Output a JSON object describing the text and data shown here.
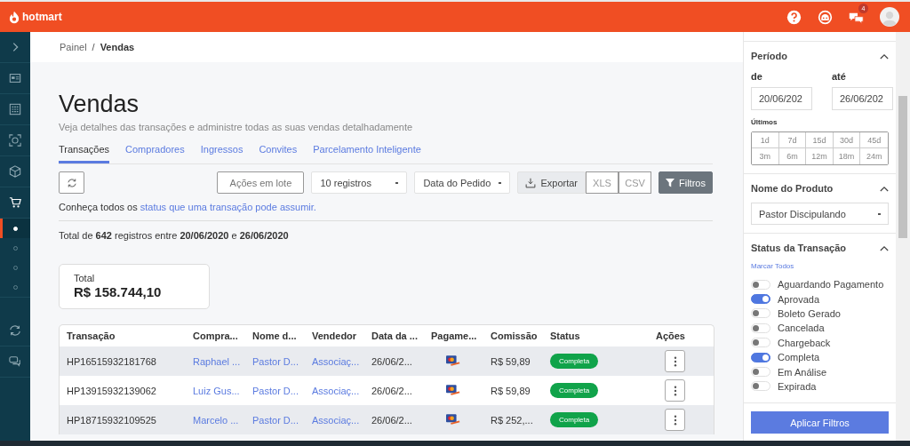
{
  "topbar": {
    "brand": "hotmart",
    "notification_badge": "4"
  },
  "sidebar": {
    "items": [
      {
        "kind": "icon",
        "selected": false
      },
      {
        "kind": "icon",
        "selected": false
      },
      {
        "kind": "icon",
        "selected": false
      },
      {
        "kind": "icon",
        "selected": false
      },
      {
        "kind": "icon",
        "selected": false
      },
      {
        "kind": "icon",
        "selected": false
      },
      {
        "kind": "dot",
        "selected": true
      },
      {
        "kind": "dot",
        "selected": false
      },
      {
        "kind": "dot",
        "selected": false
      },
      {
        "kind": "dot",
        "selected": false
      },
      {
        "kind": "icon",
        "selected": false
      },
      {
        "kind": "icon",
        "selected": false
      }
    ]
  },
  "breadcrumb": {
    "items": [
      "Painel",
      "Vendas"
    ],
    "separator": "/"
  },
  "page": {
    "title": "Vendas",
    "subtitle": "Veja detalhes das transações e administre todas as suas vendas detalhadamente"
  },
  "tabs": [
    {
      "label": "Transações",
      "selected": true
    },
    {
      "label": "Compradores",
      "selected": false
    },
    {
      "label": "Ingressos",
      "selected": false
    },
    {
      "label": "Convites",
      "selected": false
    },
    {
      "label": "Parcelamento Inteligente",
      "selected": false
    }
  ],
  "toolbar": {
    "batch_button": "Ações em lote",
    "records_select": "10 registros",
    "date_select": "Data do Pedido",
    "export_label": "Exportar",
    "export_formats": [
      "XLS",
      "CSV"
    ],
    "filters_button": "Filtros"
  },
  "status_info": {
    "text": "Conheça todos os",
    "link": "status que uma transação pode assumir."
  },
  "summary": "Total de **642** registros entre **20/06/2020** e **26/06/2020**",
  "total_card": {
    "label": "Total",
    "value": "R$ 158.744,10"
  },
  "table": {
    "columns": [
      "Transação",
      "Compra...",
      "Nome d...",
      "Vendedor",
      "Data da ...",
      "Pagame...",
      "Comissão",
      "Status",
      "Ações"
    ],
    "rows": [
      {
        "transaction": "HP16515932181768",
        "buyer": "Raphael ...",
        "product": "Pastor D...",
        "seller": "Associaç...",
        "date": "26/06/2...",
        "commission": "R$ 59,89",
        "status": "Completa"
      },
      {
        "transaction": "HP13915932139062",
        "buyer": "Luiz Gus...",
        "product": "Pastor D...",
        "seller": "Associaç...",
        "date": "26/06/2...",
        "commission": "R$ 59,89",
        "status": "Completa"
      },
      {
        "transaction": "HP18715932109525",
        "buyer": "Marcelo ...",
        "product": "Pastor D...",
        "seller": "Associaç...",
        "date": "26/06/2...",
        "commission": "R$ 252,...",
        "status": "Completa"
      }
    ]
  },
  "filters": {
    "period": {
      "title": "Período",
      "from_label": "de",
      "from_value": "20/06/202",
      "to_label": "até",
      "to_value": "26/06/202",
      "recent_label": "Últimos",
      "ranges": [
        "1d",
        "7d",
        "15d",
        "30d",
        "45d",
        "3m",
        "6m",
        "12m",
        "18m",
        "24m"
      ]
    },
    "product": {
      "title": "Nome do Produto",
      "value": "Pastor Discipulando"
    },
    "status": {
      "title": "Status da Transação",
      "select_all": "Marcar Todos",
      "options": [
        {
          "label": "Aguardando Pagamento",
          "on": false
        },
        {
          "label": "Aprovada",
          "on": true
        },
        {
          "label": "Boleto Gerado",
          "on": false
        },
        {
          "label": "Cancelada",
          "on": false
        },
        {
          "label": "Chargeback",
          "on": false
        },
        {
          "label": "Completa",
          "on": true
        },
        {
          "label": "Em Análise",
          "on": false
        },
        {
          "label": "Expirada",
          "on": false
        }
      ]
    },
    "apply_button": "Aplicar Filtros"
  }
}
